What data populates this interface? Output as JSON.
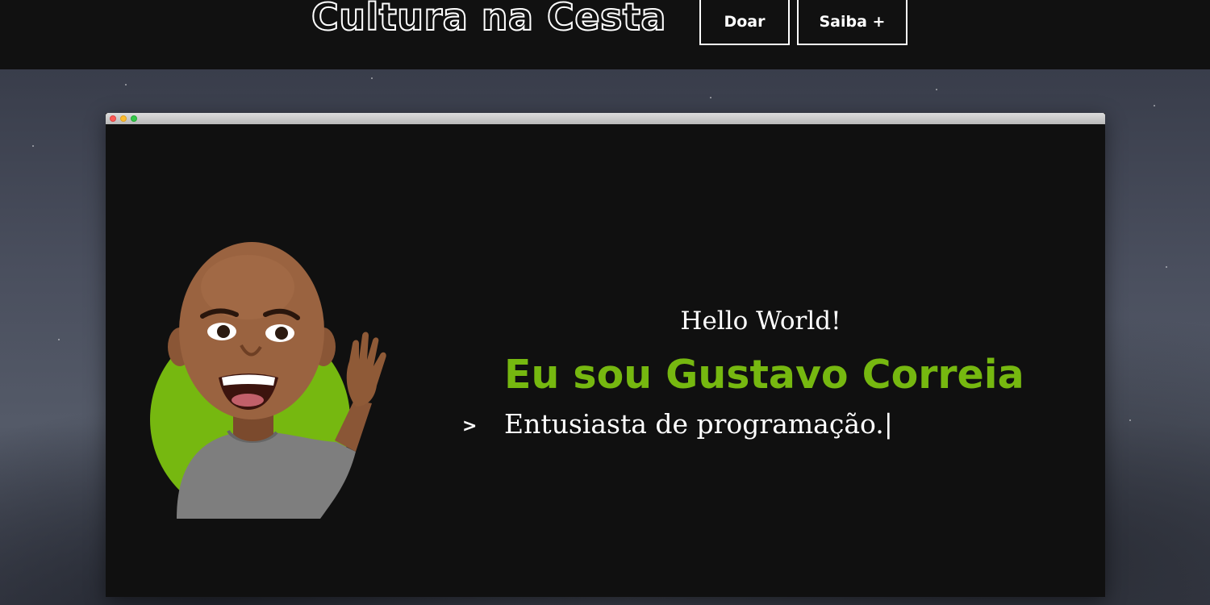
{
  "header": {
    "brand": "Cultura na Cesta",
    "nav": [
      {
        "label": "Doar"
      },
      {
        "label": "Saiba +"
      }
    ]
  },
  "hero": {
    "greeting": "Hello World!",
    "name": "Eu sou Gustavo Correia",
    "prompt_symbol": ">",
    "tagline": "Entusiasta de programação.|",
    "avatar_icon": "waving-avatar-icon"
  },
  "colors": {
    "accent": "#76b810",
    "header_bg": "#111111",
    "window_bg": "#101010"
  }
}
